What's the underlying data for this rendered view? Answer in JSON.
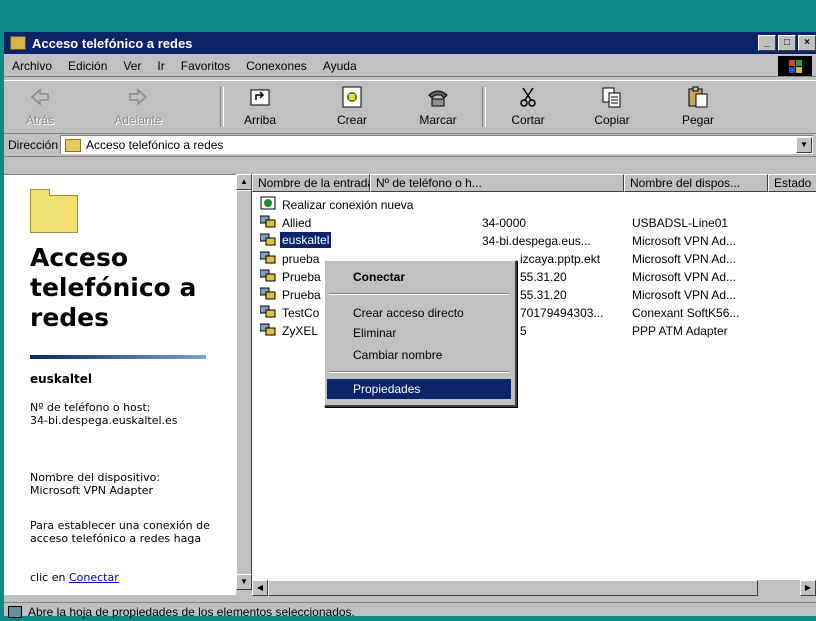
{
  "window": {
    "title": "Acceso telefónico a redes"
  },
  "menu": [
    "Archivo",
    "Edición",
    "Ver",
    "Ir",
    "Favoritos",
    "Conexones",
    "Ayuda"
  ],
  "toolbar": {
    "back": "Atrás",
    "forward": "Adelante",
    "up": "Arriba",
    "create": "Crear",
    "dial": "Marcar",
    "cut": "Cortar",
    "copy": "Copiar",
    "paste": "Pegar"
  },
  "address": {
    "label": "Dirección",
    "value": "Acceso telefónico a redes"
  },
  "left": {
    "title": "Acceso telefónico a redes",
    "selected_name": "euskaltel",
    "phone_label": "Nº de teléfono o host:",
    "phone_value": "34-bi.despega.euskaltel.es",
    "device_label": "Nombre del dispositivo:",
    "device_value": "Microsoft VPN Adapter",
    "hint": "Para establecer una conexión de acceso telefónico a redes haga",
    "hint_cut": "clic en ",
    "hint_link": "Conectar"
  },
  "columns": [
    "Nombre de la entrada",
    "Nº de teléfono o h...",
    "Nombre del dispos...",
    "Estado"
  ],
  "rows": [
    {
      "name": "Realizar conexión nueva",
      "phone": "",
      "device": ""
    },
    {
      "name": "Allied",
      "phone": "34-0000",
      "device": "USBADSL-Line01"
    },
    {
      "name": "euskaltel",
      "phone": "34-bi.despega.eus...",
      "device": "Microsoft VPN Ad..."
    },
    {
      "name": "prueba",
      "phone": "izcaya.pptp.ekt",
      "device": "Microsoft VPN Ad..."
    },
    {
      "name": "Prueba",
      "phone": "55.31.20",
      "device": "Microsoft VPN Ad..."
    },
    {
      "name": "Prueba",
      "phone": "55.31.20",
      "device": "Microsoft VPN Ad..."
    },
    {
      "name": "TestCo",
      "phone": "70179494303...",
      "device": "Conexant SoftK56..."
    },
    {
      "name": "ZyXEL",
      "phone": "5",
      "device": "PPP ATM Adapter"
    }
  ],
  "context_menu": {
    "connect": "Conectar",
    "shortcut": "Crear acceso directo",
    "delete": "Eliminar",
    "rename": "Cambiar nombre",
    "properties": "Propiedades"
  },
  "status": {
    "text": "Abre la hoja de propiedades de los elementos seleccionados."
  },
  "colors": {
    "titlebar": "#0a246a",
    "selection": "#0a246a",
    "desktop": "#0b8a8a",
    "face": "#c0c0c0"
  }
}
